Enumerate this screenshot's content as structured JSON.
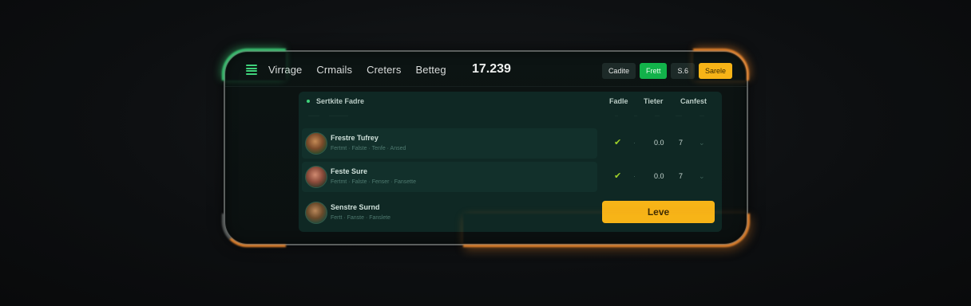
{
  "topbar": {
    "nav": [
      "Virrage",
      "Crmails",
      "Creters",
      "Betteg"
    ],
    "balance": "17.239",
    "actions": [
      {
        "label": "Cadite",
        "style": "dark"
      },
      {
        "label": "Frett",
        "style": "green"
      },
      {
        "label": "S.6",
        "style": "dark"
      },
      {
        "label": "Sarele",
        "style": "yellow"
      }
    ]
  },
  "panel": {
    "title": "Sertkite  Fadre",
    "columns": [
      "Fadle",
      "Tieter",
      "Canfest"
    ],
    "rows": [
      {
        "name": "Frestre Tufrey",
        "sub": "Fertmt · Falste · Tenfe · Ansed",
        "score": "0.0",
        "count": "7"
      },
      {
        "name": "Feste Sure",
        "sub": "Fertmt · Falste · Fenser · Fansette",
        "score": "0.0",
        "count": "7"
      }
    ],
    "last_row": {
      "name": "Senstre Surnd",
      "sub": "Fertt · Fanste · Fanslete"
    },
    "leave_label": "Leve"
  },
  "colors": {
    "accent_green": "#3fd27a",
    "accent_orange": "#f28a2e",
    "button_yellow": "#f7b417",
    "panel_bg": "#0f2824"
  }
}
